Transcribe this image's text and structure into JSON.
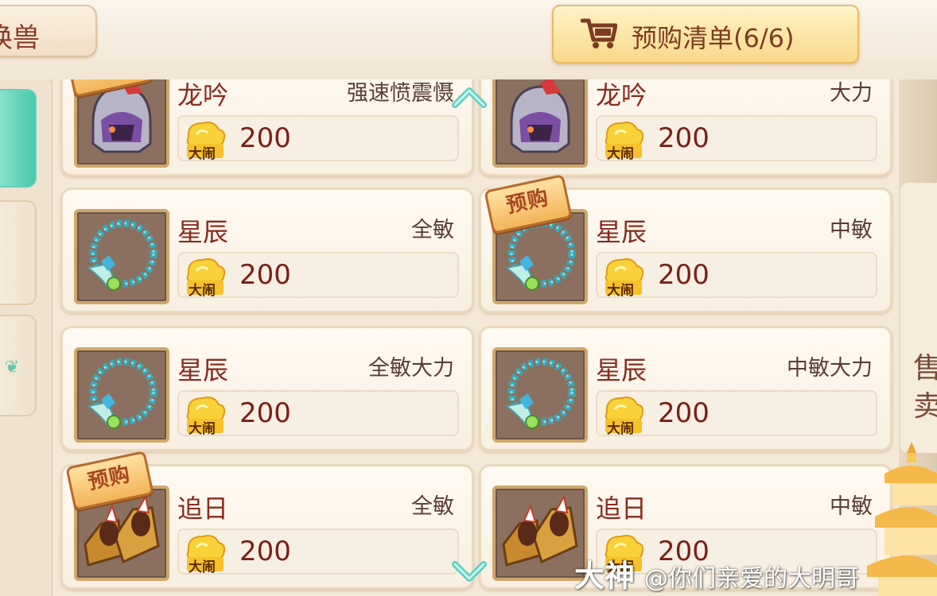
{
  "header": {
    "tab_label": "换兽",
    "cart_label": "预购清单(6/6)"
  },
  "side": {
    "vertical_text": "售卖"
  },
  "badge_text": "预购",
  "currency_label": "大闹",
  "items": [
    {
      "name": "龙吟",
      "attr": "强速愤震慑",
      "price": "200",
      "preorder": true,
      "icon": "helmet-icon"
    },
    {
      "name": "龙吟",
      "attr": "大力",
      "price": "200",
      "preorder": false,
      "icon": "helmet-icon"
    },
    {
      "name": "星辰",
      "attr": "全敏",
      "price": "200",
      "preorder": false,
      "icon": "necklace-icon"
    },
    {
      "name": "星辰",
      "attr": "中敏",
      "price": "200",
      "preorder": true,
      "icon": "necklace-icon"
    },
    {
      "name": "星辰",
      "attr": "全敏大力",
      "price": "200",
      "preorder": false,
      "icon": "necklace-icon"
    },
    {
      "name": "星辰",
      "attr": "中敏大力",
      "price": "200",
      "preorder": false,
      "icon": "necklace-icon"
    },
    {
      "name": "追日",
      "attr": "全敏",
      "price": "200",
      "preorder": true,
      "icon": "boots-icon"
    },
    {
      "name": "追日",
      "attr": "中敏",
      "price": "200",
      "preorder": false,
      "icon": "boots-icon"
    }
  ],
  "watermark": {
    "logo": "大神",
    "text": "@你们亲爱的大明哥"
  },
  "colors": {
    "title_red": "#8a2a1c",
    "price_red": "#7a1f16",
    "gold": "#f8d98a",
    "teal_active": "#46c9ad"
  }
}
